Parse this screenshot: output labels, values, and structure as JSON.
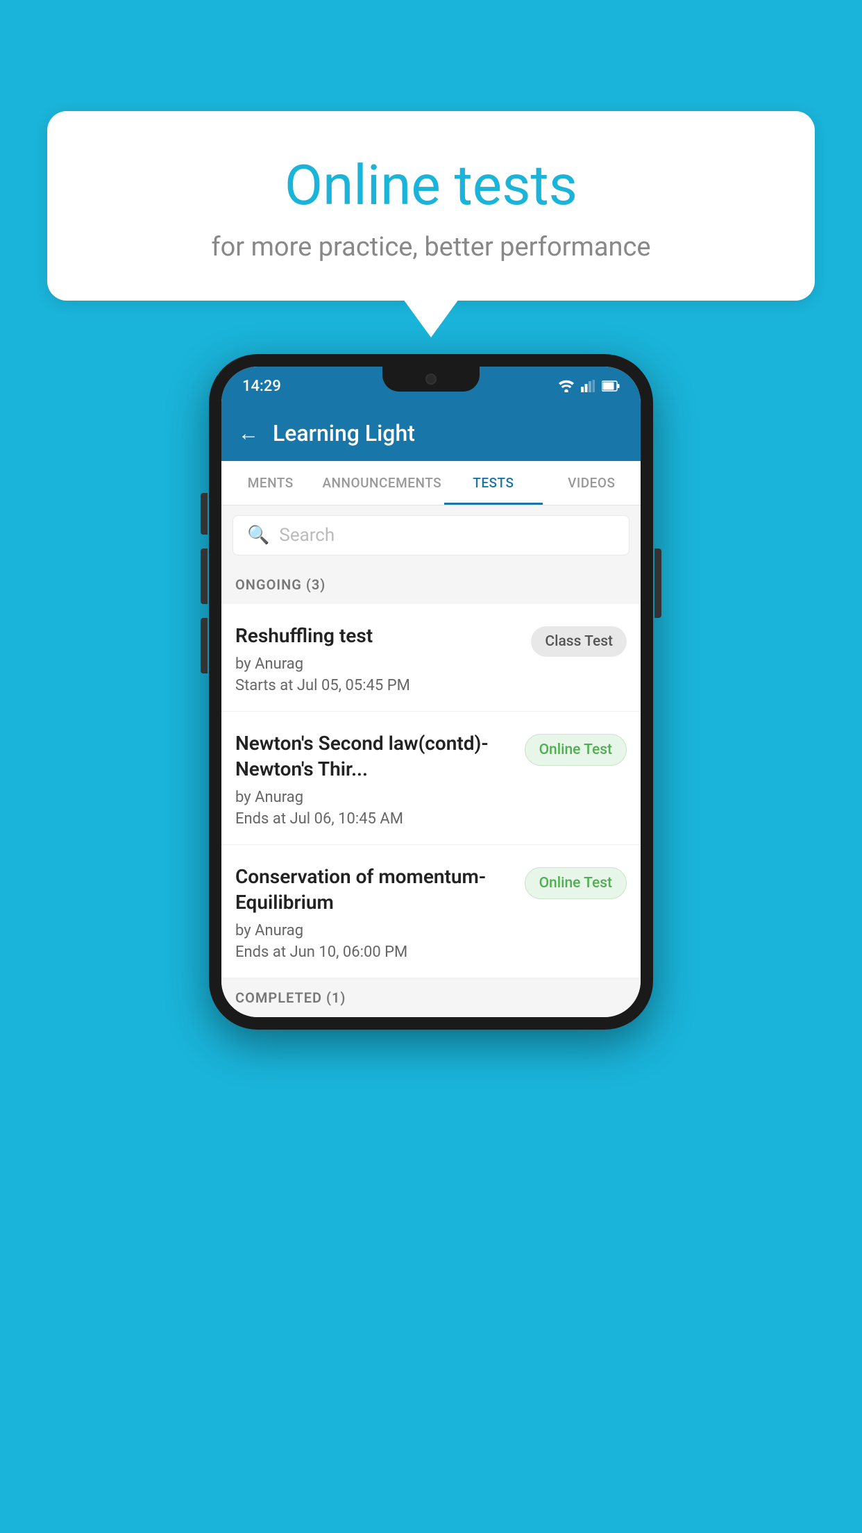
{
  "background_color": "#1ab3d9",
  "speech_bubble": {
    "title": "Online tests",
    "subtitle": "for more practice, better performance"
  },
  "phone": {
    "status_bar": {
      "time": "14:29"
    },
    "header": {
      "title": "Learning Light",
      "back_label": "←"
    },
    "tabs": [
      {
        "label": "MENTS",
        "active": false
      },
      {
        "label": "ANNOUNCEMENTS",
        "active": false
      },
      {
        "label": "TESTS",
        "active": true
      },
      {
        "label": "VIDEOS",
        "active": false
      }
    ],
    "search": {
      "placeholder": "Search"
    },
    "ongoing_section": {
      "label": "ONGOING (3)"
    },
    "tests": [
      {
        "name": "Reshuffling test",
        "by": "by Anurag",
        "time_label": "Starts at",
        "time_value": "Jul 05, 05:45 PM",
        "badge": "Class Test",
        "badge_type": "class"
      },
      {
        "name": "Newton's Second law(contd)-Newton's Thir...",
        "by": "by Anurag",
        "time_label": "Ends at",
        "time_value": "Jul 06, 10:45 AM",
        "badge": "Online Test",
        "badge_type": "online"
      },
      {
        "name": "Conservation of momentum-Equilibrium",
        "by": "by Anurag",
        "time_label": "Ends at",
        "time_value": "Jun 10, 06:00 PM",
        "badge": "Online Test",
        "badge_type": "online"
      }
    ],
    "completed_section": {
      "label": "COMPLETED (1)"
    }
  }
}
